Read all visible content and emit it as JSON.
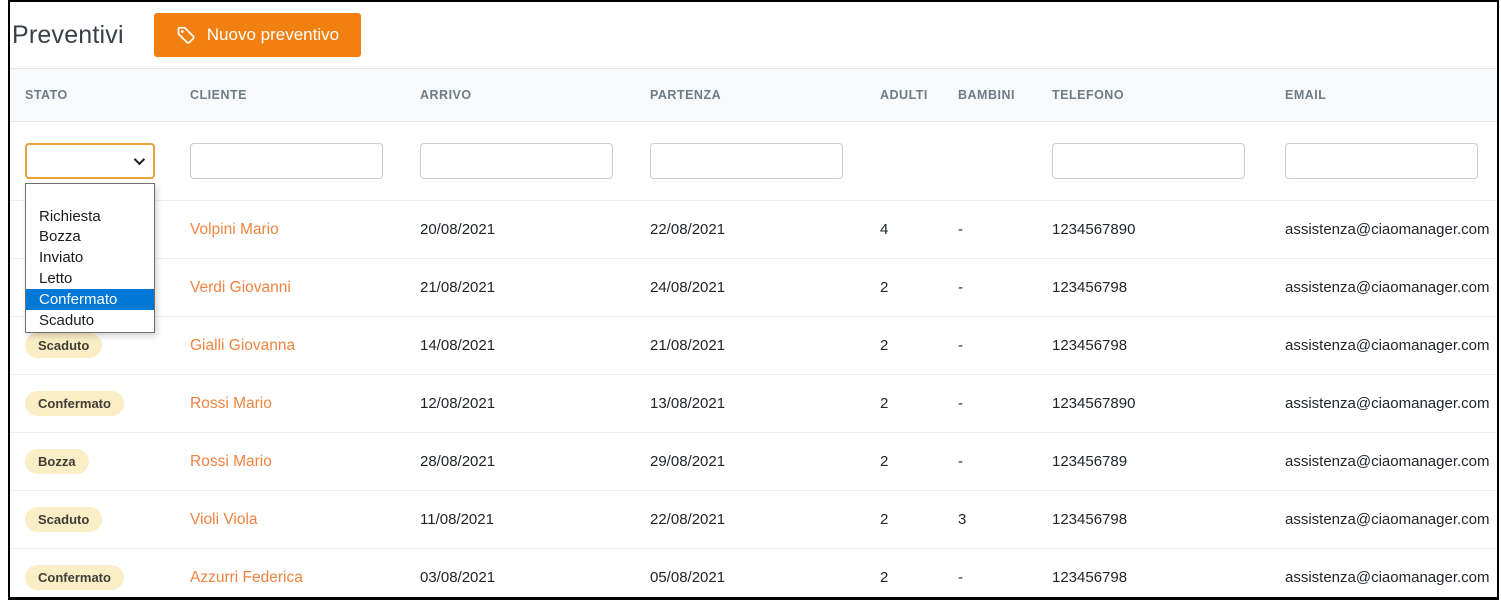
{
  "page": {
    "title": "Preventivi"
  },
  "toolbar": {
    "new_quote_label": "Nuovo preventivo",
    "accent_color": "#f28011"
  },
  "table": {
    "columns": [
      "STATO",
      "CLIENTE",
      "ARRIVO",
      "PARTENZA",
      "ADULTI",
      "BAMBINI",
      "TELEFONO",
      "EMAIL"
    ],
    "filters": {
      "stato_selected": "",
      "cliente": "",
      "arrivo": "",
      "partenza": "",
      "telefono": "",
      "email": ""
    },
    "status_filter": {
      "options": [
        "",
        "Richiesta",
        "Bozza",
        "Inviato",
        "Letto",
        "Confermato",
        "Scaduto"
      ],
      "highlighted_option": "Confermato"
    },
    "rows": [
      {
        "status": "",
        "cliente": "Volpini Mario",
        "arrivo": "20/08/2021",
        "partenza": "22/08/2021",
        "adulti": "4",
        "bambini": "-",
        "telefono": "1234567890",
        "email": "assistenza@ciaomanager.com"
      },
      {
        "status": "",
        "cliente": "Verdi Giovanni",
        "arrivo": "21/08/2021",
        "partenza": "24/08/2021",
        "adulti": "2",
        "bambini": "-",
        "telefono": "123456798",
        "email": "assistenza@ciaomanager.com"
      },
      {
        "status": "Scaduto",
        "cliente": "Gialli Giovanna",
        "arrivo": "14/08/2021",
        "partenza": "21/08/2021",
        "adulti": "2",
        "bambini": "-",
        "telefono": "123456798",
        "email": "assistenza@ciaomanager.com"
      },
      {
        "status": "Confermato",
        "cliente": "Rossi Mario",
        "arrivo": "12/08/2021",
        "partenza": "13/08/2021",
        "adulti": "2",
        "bambini": "-",
        "telefono": "1234567890",
        "email": "assistenza@ciaomanager.com"
      },
      {
        "status": "Bozza",
        "cliente": "Rossi Mario",
        "arrivo": "28/08/2021",
        "partenza": "29/08/2021",
        "adulti": "2",
        "bambini": "-",
        "telefono": "123456789",
        "email": "assistenza@ciaomanager.com"
      },
      {
        "status": "Scaduto",
        "cliente": "Violi Viola",
        "arrivo": "11/08/2021",
        "partenza": "22/08/2021",
        "adulti": "2",
        "bambini": "3",
        "telefono": "123456798",
        "email": "assistenza@ciaomanager.com"
      },
      {
        "status": "Confermato",
        "cliente": "Azzurri Federica",
        "arrivo": "03/08/2021",
        "partenza": "05/08/2021",
        "adulti": "2",
        "bambini": "-",
        "telefono": "123456798",
        "email": "assistenza@ciaomanager.com"
      }
    ]
  },
  "colors": {
    "button_orange": "#f28011",
    "client_link_orange": "#ef8340",
    "badge_background": "#faeec6",
    "dropdown_highlight_blue": "#0078d7",
    "select_focus_border": "#e9a13b"
  }
}
